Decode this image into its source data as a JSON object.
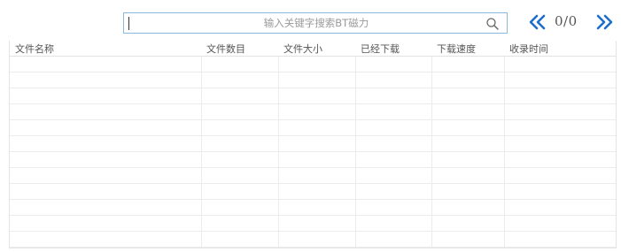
{
  "search": {
    "placeholder": "输入关键字搜索BT磁力",
    "value": ""
  },
  "pager": {
    "current": 0,
    "total": 0,
    "label": "0/0",
    "prev_icon": "double-chevron-left-icon",
    "next_icon": "double-chevron-right-icon"
  },
  "table": {
    "columns": [
      {
        "key": "name",
        "label": "文件名称"
      },
      {
        "key": "count",
        "label": "文件数目"
      },
      {
        "key": "size",
        "label": "文件大小"
      },
      {
        "key": "downloaded",
        "label": "已经下载"
      },
      {
        "key": "speed",
        "label": "下载速度"
      },
      {
        "key": "time",
        "label": "收录时间"
      }
    ],
    "rows": []
  },
  "colors": {
    "accent": "#1e6fc8",
    "search_border": "#8cb8dc",
    "grid_line": "#ececec",
    "text": "#555555"
  }
}
